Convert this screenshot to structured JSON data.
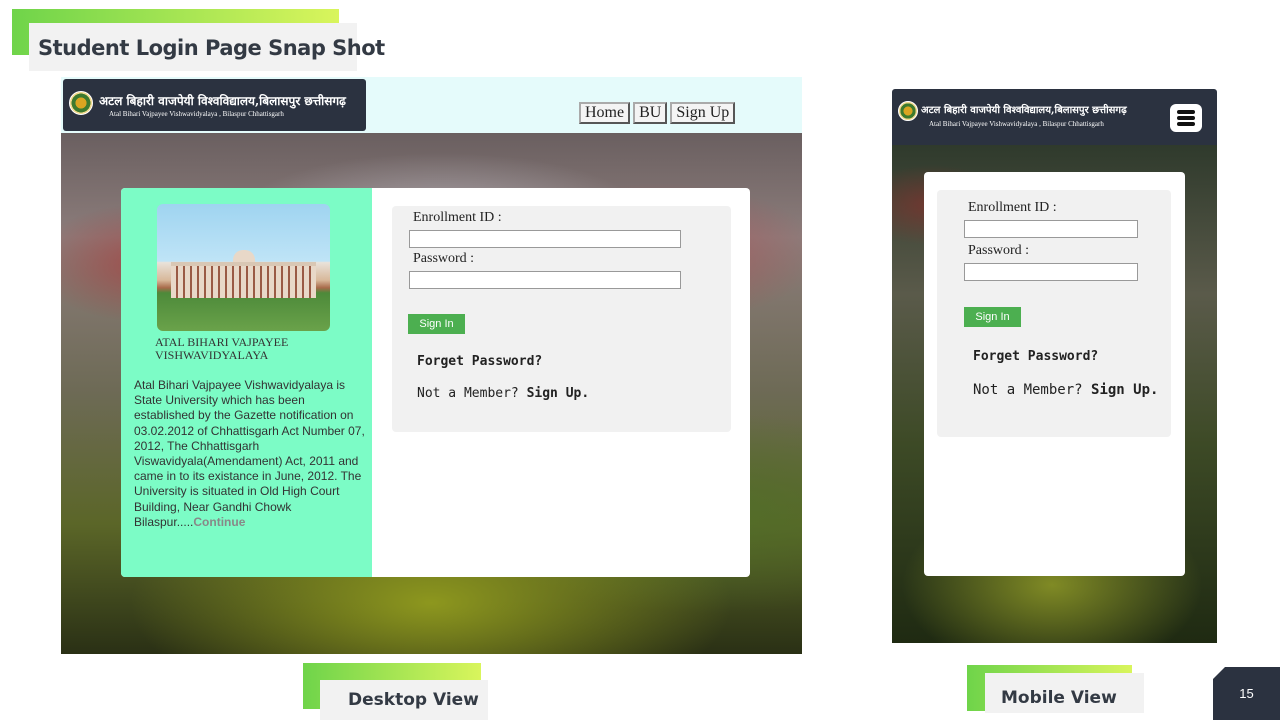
{
  "slide": {
    "title": "Student Login Page Snap Shot",
    "desktop_caption": "Desktop View",
    "mobile_caption": "Mobile View",
    "page_number": "15"
  },
  "site": {
    "name_hindi": "अटल बिहारी वाजपेयी विश्वविद्यालय,बिलासपुर छत्तीसगढ़",
    "name_english": "Atal Bihari Vajpayee Vishwavidyalaya , Bilaspur Chhattisgarh",
    "nav": [
      "Home",
      "BU",
      "Sign Up"
    ]
  },
  "about": {
    "university_name": "ATAL BIHARI VAJPAYEE VISHWAVIDYALAYA",
    "description": "Atal Bihari Vajpayee Vishwavidyalaya is State University which has been established by the Gazette notification on 03.02.2012 of Chhattisgarh Act Number 07, 2012, The Chhattisgarh Viswavidyala(Amendament) Act, 2011 and came in to its existance in June, 2012. The University is situated in Old High Court Building, Near Gandhi Chowk Bilaspur.....",
    "continue_link": "Continue"
  },
  "login": {
    "enrollment_label": "Enrollment ID :",
    "password_label": "Password :",
    "enrollment_value": "",
    "password_value": "",
    "signin_label": "Sign In",
    "forgot_label": "Forget Password?",
    "not_member_label": "Not a Member?",
    "signup_link": "Sign Up."
  },
  "colors": {
    "accent_gradient_start": "#6fd44a",
    "accent_gradient_end": "#d9f55c",
    "header_dark": "#2b3240",
    "about_panel": "#7cfcc6",
    "signin_button": "#4caf50"
  },
  "icons": {
    "university_emblem": "emblem-icon",
    "mobile_menu": "hamburger-menu-icon"
  }
}
